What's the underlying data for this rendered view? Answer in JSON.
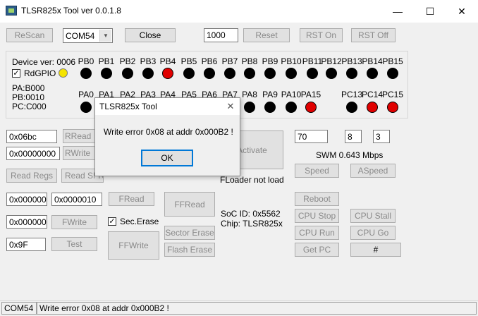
{
  "window": {
    "title": "TLSR825x Tool ver 0.0.1.8",
    "min": "—",
    "max": "☐",
    "close": "✕"
  },
  "toolbar": {
    "rescan": "ReScan",
    "port": "COM54",
    "close": "Close",
    "baud": "1000",
    "reset": "Reset",
    "rst_on": "RST On",
    "rst_off": "RST Off"
  },
  "gpio": {
    "device_ver": "Device ver: 0006",
    "rdgpio": "RdGPIO",
    "pa": "PA:B000",
    "pb": "PB:0010",
    "pc": "PC:C000",
    "row1_labels": [
      "PB0",
      "PB1",
      "PB2",
      "PB3",
      "PB4",
      "PB5",
      "PB6",
      "PB7",
      "PB8",
      "PB9",
      "PB10",
      "PB11",
      "PB12",
      "PB13",
      "PB14",
      "PB15"
    ],
    "row1_states": [
      "off",
      "off",
      "off",
      "off",
      "on",
      "off",
      "off",
      "off",
      "off",
      "off",
      "off",
      "off",
      "off",
      "off",
      "off",
      "off"
    ],
    "row2_labels": [
      "PA0",
      "PA1",
      "PA2",
      "PA3",
      "PA4",
      "PA5",
      "PA6",
      "PA7",
      "PA8",
      "PA9",
      "PA10",
      "PA15",
      "PC13",
      "PC14",
      "PC15"
    ],
    "row2_states": [
      "off",
      "off",
      "off",
      "off",
      "off",
      "off",
      "off",
      "off",
      "off",
      "off",
      "off",
      "on",
      "off",
      "on",
      "on"
    ],
    "colors": {
      "on": "#e00000",
      "off": "#000000",
      "indicator": "#f5e400"
    }
  },
  "regs": {
    "addr": "0x06bc",
    "value": "0x00000000",
    "rread": "RRead",
    "rwrite": "RWrite",
    "read_regs": "Read Regs",
    "read_sfr": "Read SFR"
  },
  "activate": {
    "label": "Activate",
    "floader": "FLoader not load"
  },
  "swm": {
    "v1": "70",
    "v2": "8",
    "v3": "3",
    "rate": "SWM 0.643 Mbps",
    "speed": "Speed",
    "aspeed": "ASpeed"
  },
  "flash": {
    "addr": "0x000000",
    "len": "0x0000010",
    "fread": "FRead",
    "waddr": "0x000000",
    "fwrite": "FWrite",
    "sec_erase": "Sec.Erase",
    "test_val": "0x9F",
    "test": "Test",
    "ffread": "FFRead",
    "ffwrite": "FFWrite",
    "sector_erase": "Sector Erase",
    "flash_erase": "Flash Erase"
  },
  "soc": {
    "id": "SoC ID: 0x5562",
    "chip": "Chip: TLSR825x"
  },
  "cpu": {
    "reboot": "Reboot",
    "stop": "CPU Stop",
    "stall": "CPU Stall",
    "run": "CPU Run",
    "go": "CPU Go",
    "get_pc": "Get PC",
    "hash": "#"
  },
  "dialog": {
    "title": "TLSR825x Tool",
    "message": "Write error 0x08 at addr 0x000B2 !",
    "ok": "OK",
    "close": "✕"
  },
  "status": {
    "port": "COM54",
    "message": "Write error 0x08 at addr 0x000B2 !"
  }
}
